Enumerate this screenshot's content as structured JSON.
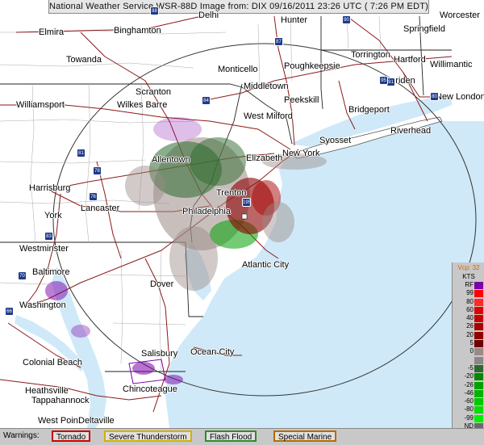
{
  "title": "National Weather Service WSR-88D Image from: DIX 09/16/2011 23:26 UTC ( 7:26 PM EDT)",
  "colors": {
    "land": "#ffffff",
    "ocean": "#cfe9f8",
    "roads": "#8b1a1a",
    "borders": "#222222",
    "range_ring": "#333333"
  },
  "places": [
    {
      "id": "elmira",
      "label": "Elmira"
    },
    {
      "id": "binghamton",
      "label": "Binghamton"
    },
    {
      "id": "delhi",
      "label": "Delhi"
    },
    {
      "id": "hunter",
      "label": "Hunter"
    },
    {
      "id": "springfield",
      "label": "Springfield"
    },
    {
      "id": "worcester",
      "label": "Worcester"
    },
    {
      "id": "towanda",
      "label": "Towanda"
    },
    {
      "id": "monticello",
      "label": "Monticello"
    },
    {
      "id": "poughkeepsie",
      "label": "Poughkeepsie"
    },
    {
      "id": "torrington",
      "label": "Torrington"
    },
    {
      "id": "hartford",
      "label": "Hartford"
    },
    {
      "id": "willimantic",
      "label": "Willimantic"
    },
    {
      "id": "meriden",
      "label": "Meriden"
    },
    {
      "id": "middletown",
      "label": "Middletown"
    },
    {
      "id": "scranton",
      "label": "Scranton"
    },
    {
      "id": "wilkes_barre",
      "label": "Wilkes Barre"
    },
    {
      "id": "peekskill",
      "label": "Peekskill"
    },
    {
      "id": "bridgeport",
      "label": "Bridgeport"
    },
    {
      "id": "new_london",
      "label": "New London"
    },
    {
      "id": "williamsport",
      "label": "Williamsport"
    },
    {
      "id": "west_milford",
      "label": "West Milford"
    },
    {
      "id": "riverhead",
      "label": "Riverhead"
    },
    {
      "id": "syosset",
      "label": "Syosset"
    },
    {
      "id": "new_york",
      "label": "New York"
    },
    {
      "id": "allentown",
      "label": "Allentown"
    },
    {
      "id": "elizabeth",
      "label": "Elizabeth"
    },
    {
      "id": "harrisburg",
      "label": "Harrisburg"
    },
    {
      "id": "trenton",
      "label": "Trenton"
    },
    {
      "id": "lancaster",
      "label": "Lancaster"
    },
    {
      "id": "philadelphia",
      "label": "Philadelphia"
    },
    {
      "id": "york",
      "label": "York"
    },
    {
      "id": "westminster",
      "label": "Westminster"
    },
    {
      "id": "atlantic_city",
      "label": "Atlantic City"
    },
    {
      "id": "baltimore",
      "label": "Baltimore"
    },
    {
      "id": "dover",
      "label": "Dover"
    },
    {
      "id": "washington",
      "label": "Washington"
    },
    {
      "id": "salisbury",
      "label": "Salisbury"
    },
    {
      "id": "ocean_city",
      "label": "Ocean City"
    },
    {
      "id": "colonial_beach",
      "label": "Colonial Beach"
    },
    {
      "id": "heathsville",
      "label": "Heathsville"
    },
    {
      "id": "tappahannock",
      "label": "Tappahannock"
    },
    {
      "id": "chincoteague",
      "label": "Chincoteague"
    },
    {
      "id": "west_point",
      "label": "West Point"
    },
    {
      "id": "eltaville",
      "label": "Deltaville"
    }
  ],
  "highway_shields": [
    {
      "id": "i88",
      "label": "88"
    },
    {
      "id": "i84",
      "label": "84"
    },
    {
      "id": "i87",
      "label": "87"
    },
    {
      "id": "i90",
      "label": "90"
    },
    {
      "id": "i91",
      "label": "91"
    },
    {
      "id": "i80",
      "label": "80"
    },
    {
      "id": "i81",
      "label": "81"
    },
    {
      "id": "i78",
      "label": "78"
    },
    {
      "id": "i76",
      "label": "76"
    },
    {
      "id": "i195",
      "label": "195"
    },
    {
      "id": "i83",
      "label": "83"
    },
    {
      "id": "i70",
      "label": "70"
    },
    {
      "id": "i66",
      "label": "66"
    },
    {
      "id": "i95",
      "label": "95"
    }
  ],
  "legend": {
    "vcp": "Vcp: 32",
    "unit": "KTS",
    "entries": [
      {
        "label": "RF",
        "color": "#7a00a8"
      },
      {
        "label": "99",
        "color": "#ff0000"
      },
      {
        "label": "80",
        "color": "#ff2a2a"
      },
      {
        "label": "60",
        "color": "#e00000"
      },
      {
        "label": "40",
        "color": "#c40000"
      },
      {
        "label": "26",
        "color": "#a80000"
      },
      {
        "label": "20",
        "color": "#8c0000"
      },
      {
        "label": "5",
        "color": "#6e0000"
      },
      {
        "label": "0",
        "color": "#9a8a85"
      },
      {
        "label": "",
        "color": "#888888"
      },
      {
        "label": "-5",
        "color": "#2c6a2c"
      },
      {
        "label": "-20",
        "color": "#008800"
      },
      {
        "label": "-26",
        "color": "#00a000"
      },
      {
        "label": "-46",
        "color": "#00b400"
      },
      {
        "label": "-60",
        "color": "#00c800"
      },
      {
        "label": "-80",
        "color": "#00dc00"
      },
      {
        "label": "-99",
        "color": "#00f000"
      },
      {
        "label": "ND",
        "color": "#6a6a6a"
      }
    ]
  },
  "warnings": {
    "title": "Warnings:",
    "items": [
      {
        "label": "Tornado",
        "border": "#cc0000"
      },
      {
        "label": "Severe Thunderstorm",
        "border": "#d4b000"
      },
      {
        "label": "Flash Flood",
        "border": "#2e8b2e"
      },
      {
        "label": "Special Marine",
        "border": "#b86a00"
      }
    ]
  }
}
